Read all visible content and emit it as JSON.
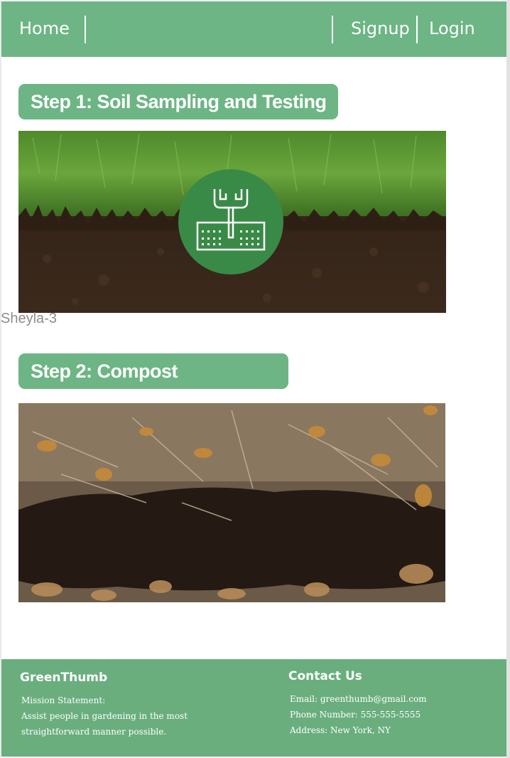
{
  "nav": {
    "home": "Home",
    "signup": "Signup",
    "login": "Login"
  },
  "steps": [
    {
      "title": "Step 1:  Soil Sampling and Testing",
      "image": "soil-cross-section-photo",
      "icon": "soil-sampling-probe-icon"
    },
    {
      "title": "Step 2: Compost",
      "image": "compost-pile-photo"
    }
  ],
  "caption": "Sheyla-3",
  "footer": {
    "brand": "GreenThumb",
    "mission_label": "Mission Statement:",
    "mission_line1": "Assist people in gardening in the most",
    "mission_line2": "straightforward manner possible.",
    "contact_title": "Contact Us",
    "email": "Email: greenthumb@gmail.com",
    "phone": "Phone Number: 555-555-5555",
    "address": "Address: New York, NY"
  },
  "colors": {
    "primary_green": "#6db584",
    "icon_circle": "#3a8a47",
    "white": "#ffffff"
  }
}
